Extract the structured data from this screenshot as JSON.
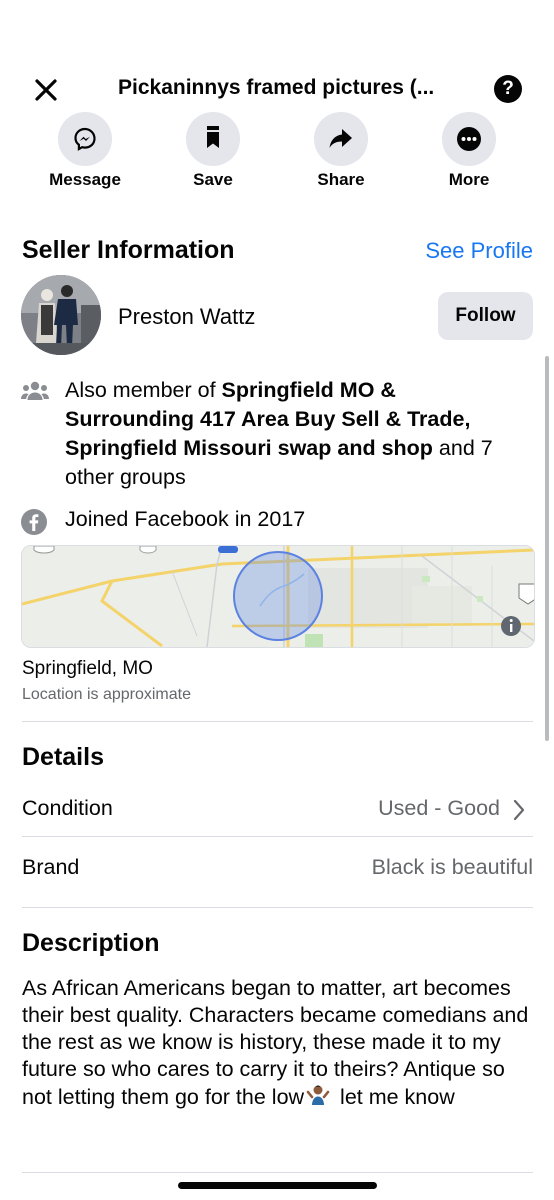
{
  "header": {
    "title": "Pickaninnys framed pictures (...",
    "help": "?"
  },
  "actions": [
    {
      "label": "Message",
      "icon": "messenger-icon"
    },
    {
      "label": "Save",
      "icon": "bookmark-icon"
    },
    {
      "label": "Share",
      "icon": "share-arrow-icon"
    },
    {
      "label": "More",
      "icon": "more-dots-icon"
    }
  ],
  "seller": {
    "heading": "Seller Information",
    "see_profile": "See Profile",
    "name": "Preston Wattz",
    "follow": "Follow",
    "groups_prefix": "Also member of ",
    "group1": "Springfield MO & Surrounding 417 Area Buy Sell & Trade",
    "comma": ", ",
    "group2": "Springfield Missouri swap and shop",
    "groups_suffix": " and 7 other groups",
    "joined": "Joined Facebook in 2017"
  },
  "location": {
    "city": "Springfield, MO",
    "note": "Location is approximate"
  },
  "details": {
    "heading": "Details",
    "condition_label": "Condition",
    "condition_value": "Used - Good",
    "brand_label": "Brand",
    "brand_value": "Black is beautiful"
  },
  "description": {
    "heading": "Description",
    "text_main": "As African Americans began to matter, art becomes their best quality. Characters became comedians and the rest as we know is history, these made it to my future so who cares to carry it to theirs? Antique so not letting them go for the low",
    "text_end": " let me know"
  },
  "colors": {
    "link": "#1877f2",
    "button_bg": "#e4e6eb",
    "muted": "#65676b"
  }
}
